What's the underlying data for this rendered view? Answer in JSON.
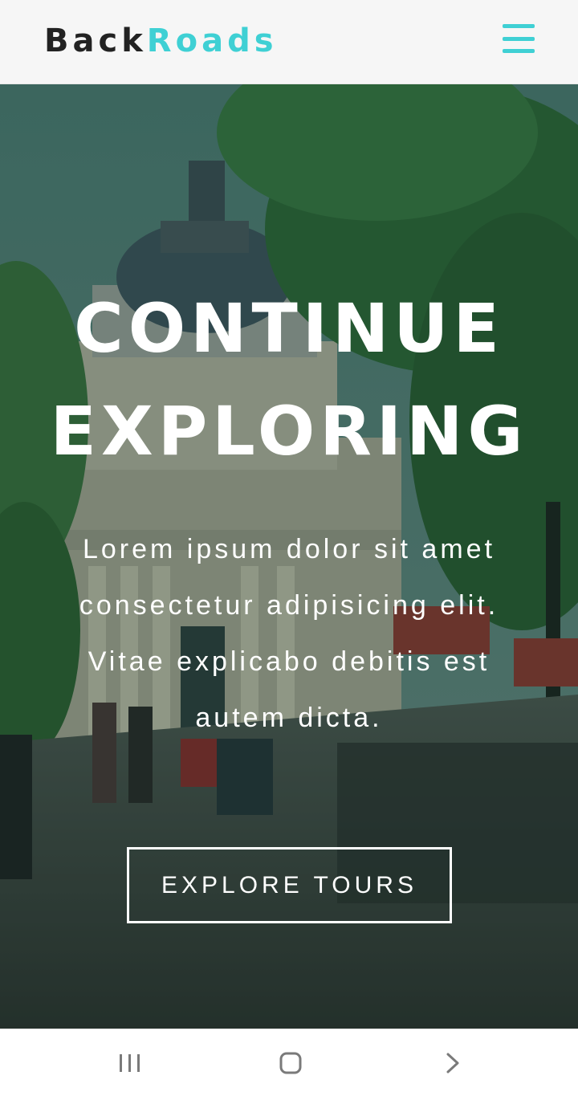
{
  "header": {
    "logo_part1": "Back",
    "logo_part2": "Roads",
    "menu_icon": "hamburger-menu-icon",
    "accent_color": "#3fd0d4"
  },
  "hero": {
    "title_line1": "CONTINUE",
    "title_line2": "EXPLORING",
    "text": "Lorem ipsum dolor sit amet consectetur adipisicing elit. Vitae explicabo debitis est autem dicta.",
    "button_label": "EXPLORE TOURS",
    "background_image": "street-scene-with-domed-building-photo"
  },
  "system_nav": {
    "recent_icon": "recent-apps-icon",
    "home_icon": "home-icon",
    "back_icon": "back-chevron-icon"
  }
}
